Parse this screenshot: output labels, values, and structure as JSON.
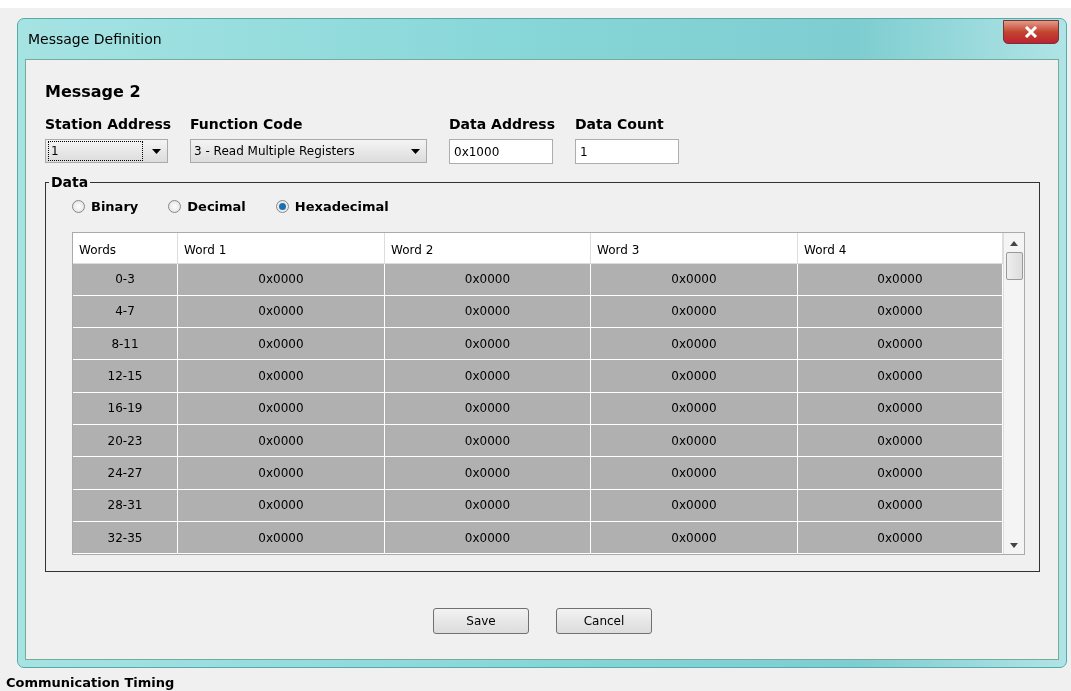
{
  "window": {
    "title": "Message Definition"
  },
  "heading": "Message 2",
  "fields": [
    {
      "kind": "select",
      "label": "Station Address",
      "value": "1",
      "focused": true
    },
    {
      "kind": "select",
      "label": "Function Code",
      "value": "3 - Read Multiple Registers",
      "focused": false
    },
    {
      "kind": "text",
      "label": "Data Address",
      "value": "0x1000"
    },
    {
      "kind": "text",
      "label": "Data Count",
      "value": "1"
    }
  ],
  "data": {
    "legend": "Data",
    "formats": [
      {
        "label": "Binary",
        "selected": false
      },
      {
        "label": "Decimal",
        "selected": false
      },
      {
        "label": "Hexadecimal",
        "selected": true
      }
    ],
    "table": {
      "columns": [
        "Words",
        "Word 1",
        "Word 2",
        "Word 3",
        "Word 4"
      ],
      "rows": [
        [
          "0-3",
          "0x0000",
          "0x0000",
          "0x0000",
          "0x0000"
        ],
        [
          "4-7",
          "0x0000",
          "0x0000",
          "0x0000",
          "0x0000"
        ],
        [
          "8-11",
          "0x0000",
          "0x0000",
          "0x0000",
          "0x0000"
        ],
        [
          "12-15",
          "0x0000",
          "0x0000",
          "0x0000",
          "0x0000"
        ],
        [
          "16-19",
          "0x0000",
          "0x0000",
          "0x0000",
          "0x0000"
        ],
        [
          "20-23",
          "0x0000",
          "0x0000",
          "0x0000",
          "0x0000"
        ],
        [
          "24-27",
          "0x0000",
          "0x0000",
          "0x0000",
          "0x0000"
        ],
        [
          "28-31",
          "0x0000",
          "0x0000",
          "0x0000",
          "0x0000"
        ],
        [
          "32-35",
          "0x0000",
          "0x0000",
          "0x0000",
          "0x0000"
        ]
      ]
    }
  },
  "buttons": [
    "Save",
    "Cancel"
  ],
  "background": {
    "section_title": "Communication Timing"
  }
}
